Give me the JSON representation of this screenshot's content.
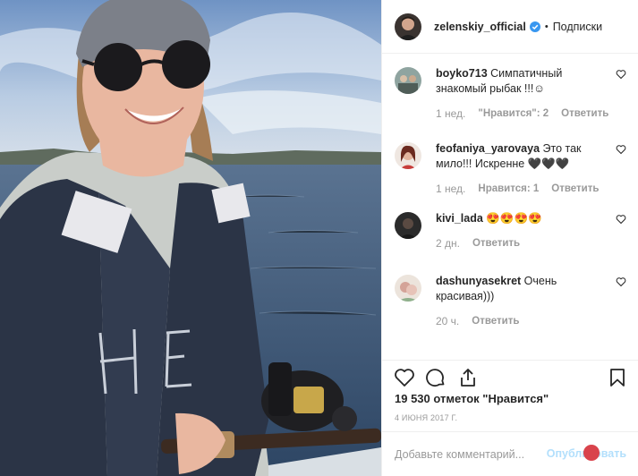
{
  "header": {
    "username": "zelenskiy_official",
    "separator": "•",
    "follow_label": "Подписки"
  },
  "comments": [
    {
      "user": "boyko713",
      "text": "Симпатичный знакомый рыбак !!!☺",
      "time": "1 нед.",
      "likes": "\"Нравится\": 2",
      "reply": "Ответить"
    },
    {
      "user": "feofaniya_yarovaya",
      "text": "Это так мило!!! Искренне 🖤🖤🖤",
      "time": "1 нед.",
      "likes": "Нравится: 1",
      "reply": "Ответить"
    },
    {
      "user": "kivi_lada",
      "text": "😍😍😍😍",
      "time": "2 дн.",
      "likes": "",
      "reply": "Ответить"
    },
    {
      "user": "dashunyasekret",
      "text": "Очень красивая)))",
      "time": "20 ч.",
      "likes": "",
      "reply": "Ответить"
    }
  ],
  "post": {
    "likes_total": "19 530 отметок \"Нравится\"",
    "date": "4 ИЮНЯ 2017 Г."
  },
  "add_comment": {
    "placeholder": "Добавьте комментарий...",
    "publish_label": "Опубликовать"
  },
  "colors": {
    "verified": "#3897f0",
    "muted": "#999999",
    "publish_disabled": "#b2dffc"
  },
  "icons": [
    "heart-icon",
    "comment-icon",
    "share-icon",
    "bookmark-icon",
    "verified-badge-icon"
  ]
}
